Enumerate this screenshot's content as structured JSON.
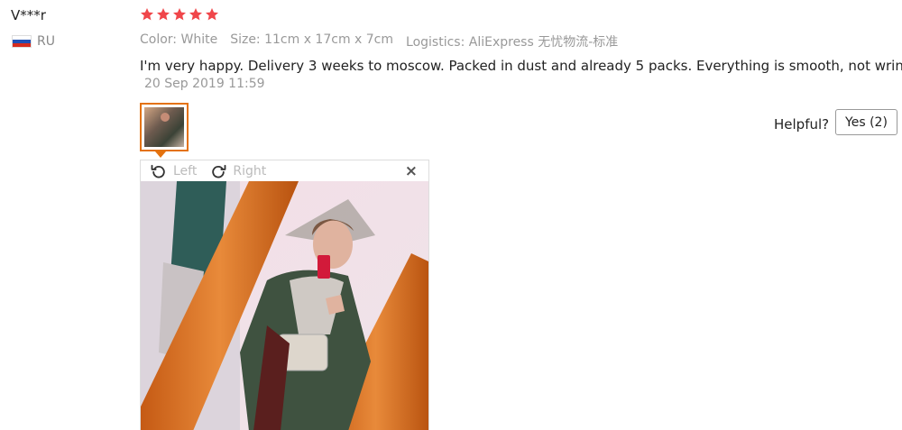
{
  "reviewer": {
    "name": "V***r",
    "country": "RU"
  },
  "rating": {
    "stars": 5,
    "max": 5,
    "color": "#f0464a"
  },
  "attributes": {
    "color": "Color: White",
    "size": "Size: 11cm x 17cm x 7cm",
    "logistics": "Logistics: AliExpress 无忧物流-标准"
  },
  "review": {
    "text": "I'm very happy. Delivery 3 weeks to moscow. Packed in dust and already 5 packs. Everything is smooth, not wrinkled!",
    "date": "20 Sep 2019 11:59"
  },
  "helpful": {
    "label": "Helpful?",
    "button": "Yes (2)"
  },
  "viewer": {
    "rotate_left": "Left",
    "rotate_right": "Right",
    "close": "×"
  },
  "colors": {
    "accent": "#e4720f",
    "muted": "#999999"
  },
  "icons": [
    "flag-russia-icon",
    "star-icon",
    "rotate-left-icon",
    "rotate-right-icon",
    "close-icon"
  ]
}
